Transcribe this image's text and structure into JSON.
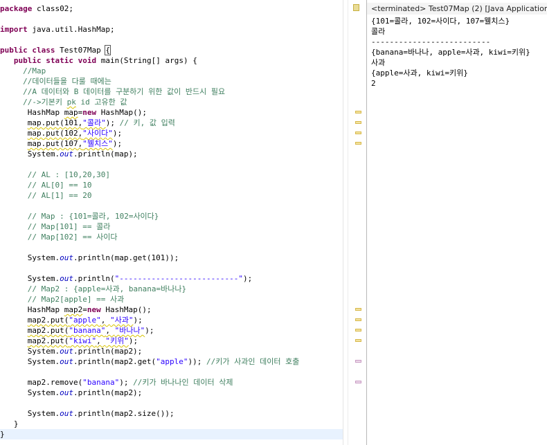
{
  "editor": {
    "lines": [
      {
        "segs": [
          {
            "t": "package",
            "c": "kw"
          },
          {
            "t": " class02;"
          }
        ]
      },
      {
        "segs": []
      },
      {
        "segs": [
          {
            "t": "import",
            "c": "kw"
          },
          {
            "t": " java.util.HashMap;"
          }
        ]
      },
      {
        "segs": []
      },
      {
        "segs": [
          {
            "t": "public",
            "c": "kw"
          },
          {
            "t": " "
          },
          {
            "t": "class",
            "c": "kw"
          },
          {
            "t": " Test07Map "
          },
          {
            "t": "{",
            "c": "box"
          }
        ]
      },
      {
        "segs": [
          {
            "t": "   "
          },
          {
            "t": "public",
            "c": "kw"
          },
          {
            "t": " "
          },
          {
            "t": "static",
            "c": "kw"
          },
          {
            "t": " "
          },
          {
            "t": "void",
            "c": "kw"
          },
          {
            "t": " main(String[] args) {"
          }
        ]
      },
      {
        "segs": [
          {
            "t": "     "
          },
          {
            "t": "//Map",
            "c": "cm"
          }
        ]
      },
      {
        "segs": [
          {
            "t": "     "
          },
          {
            "t": "//데이터들을 다룰 때에는",
            "c": "cm"
          }
        ]
      },
      {
        "segs": [
          {
            "t": "     "
          },
          {
            "t": "//A 데이터와 B 데이터를 구분하기 위한 값이 반드시 필요",
            "c": "cm"
          }
        ]
      },
      {
        "segs": [
          {
            "t": "     "
          },
          {
            "t": "//->기본키 ",
            "c": "cm"
          },
          {
            "t": "pk",
            "c": "cm ann"
          },
          {
            "t": " id 고유한 값",
            "c": "cm"
          }
        ]
      },
      {
        "segs": [
          {
            "t": "      HashMap "
          },
          {
            "t": "map",
            "c": "ann"
          },
          {
            "t": "="
          },
          {
            "t": "new",
            "c": "kw"
          },
          {
            "t": " HashMap();"
          }
        ]
      },
      {
        "segs": [
          {
            "t": "      "
          },
          {
            "t": "map.put(101,",
            "c": "ann"
          },
          {
            "t": "\"콜라\"",
            "c": "st ann"
          },
          {
            "t": "); "
          },
          {
            "t": "// 키, 값 입력",
            "c": "cm"
          }
        ]
      },
      {
        "segs": [
          {
            "t": "      "
          },
          {
            "t": "map.put(102,",
            "c": "ann"
          },
          {
            "t": "\"사이다\"",
            "c": "st ann"
          },
          {
            "t": ");"
          }
        ]
      },
      {
        "segs": [
          {
            "t": "      "
          },
          {
            "t": "map.put(107,",
            "c": "ann"
          },
          {
            "t": "\"웰치스\"",
            "c": "st ann"
          },
          {
            "t": ");"
          }
        ]
      },
      {
        "segs": [
          {
            "t": "      System."
          },
          {
            "t": "out",
            "c": "it"
          },
          {
            "t": ".println(map);"
          }
        ]
      },
      {
        "segs": []
      },
      {
        "segs": [
          {
            "t": "      "
          },
          {
            "t": "// AL : [10,20,30]",
            "c": "cm"
          }
        ]
      },
      {
        "segs": [
          {
            "t": "      "
          },
          {
            "t": "// AL[0] == 10",
            "c": "cm"
          }
        ]
      },
      {
        "segs": [
          {
            "t": "      "
          },
          {
            "t": "// AL[1] == 20",
            "c": "cm"
          }
        ]
      },
      {
        "segs": []
      },
      {
        "segs": [
          {
            "t": "      "
          },
          {
            "t": "// Map : {101=콜라, 102=사이다}",
            "c": "cm"
          }
        ]
      },
      {
        "segs": [
          {
            "t": "      "
          },
          {
            "t": "// Map[101] == 콜라",
            "c": "cm"
          }
        ]
      },
      {
        "segs": [
          {
            "t": "      "
          },
          {
            "t": "// Map[102] == 사이다",
            "c": "cm"
          }
        ]
      },
      {
        "segs": []
      },
      {
        "segs": [
          {
            "t": "      System."
          },
          {
            "t": "out",
            "c": "it"
          },
          {
            "t": ".println(map.get(101));"
          }
        ]
      },
      {
        "segs": []
      },
      {
        "segs": [
          {
            "t": "      System."
          },
          {
            "t": "out",
            "c": "it"
          },
          {
            "t": ".println("
          },
          {
            "t": "\"--------------------------\"",
            "c": "st"
          },
          {
            "t": ");"
          }
        ]
      },
      {
        "segs": [
          {
            "t": "      "
          },
          {
            "t": "// Map2 : {apple=사과, banana=바나나}",
            "c": "cm"
          }
        ]
      },
      {
        "segs": [
          {
            "t": "      "
          },
          {
            "t": "// Map2[apple] == 사과",
            "c": "cm"
          }
        ]
      },
      {
        "segs": [
          {
            "t": "      HashMap "
          },
          {
            "t": "map2",
            "c": "ann"
          },
          {
            "t": "="
          },
          {
            "t": "new",
            "c": "kw"
          },
          {
            "t": " HashMap();"
          }
        ]
      },
      {
        "segs": [
          {
            "t": "      "
          },
          {
            "t": "map2.put(",
            "c": "ann"
          },
          {
            "t": "\"apple\"",
            "c": "st ann"
          },
          {
            "t": ", ",
            "c": "ann"
          },
          {
            "t": "\"사과\"",
            "c": "st ann"
          },
          {
            "t": ");"
          }
        ]
      },
      {
        "segs": [
          {
            "t": "      "
          },
          {
            "t": "map2.put(",
            "c": "ann"
          },
          {
            "t": "\"banana\"",
            "c": "st ann"
          },
          {
            "t": ", ",
            "c": "ann"
          },
          {
            "t": "\"바나나\"",
            "c": "st ann"
          },
          {
            "t": ");"
          }
        ]
      },
      {
        "segs": [
          {
            "t": "      "
          },
          {
            "t": "map2.put(",
            "c": "ann"
          },
          {
            "t": "\"kiwi\"",
            "c": "st ann"
          },
          {
            "t": ", ",
            "c": "ann"
          },
          {
            "t": "\"키위\"",
            "c": "st ann"
          },
          {
            "t": ");"
          }
        ]
      },
      {
        "segs": [
          {
            "t": "      System."
          },
          {
            "t": "out",
            "c": "it"
          },
          {
            "t": ".println(map2);"
          }
        ]
      },
      {
        "segs": [
          {
            "t": "      System."
          },
          {
            "t": "out",
            "c": "it"
          },
          {
            "t": ".println(map2.get("
          },
          {
            "t": "\"apple\"",
            "c": "st"
          },
          {
            "t": ")); "
          },
          {
            "t": "//키가 사과인 데이터 호출",
            "c": "cm"
          }
        ]
      },
      {
        "segs": []
      },
      {
        "segs": [
          {
            "t": "      map2.remove("
          },
          {
            "t": "\"banana\"",
            "c": "st"
          },
          {
            "t": "); "
          },
          {
            "t": "//키가 바나나인 데이터 삭제",
            "c": "cm"
          }
        ]
      },
      {
        "segs": [
          {
            "t": "      System."
          },
          {
            "t": "out",
            "c": "it"
          },
          {
            "t": ".println(map2);"
          }
        ]
      },
      {
        "segs": []
      },
      {
        "segs": [
          {
            "t": "      System."
          },
          {
            "t": "out",
            "c": "it"
          },
          {
            "t": ".println(map2.size());"
          }
        ]
      },
      {
        "segs": [
          {
            "t": "   }"
          }
        ]
      },
      {
        "segs": [
          {
            "t": "}"
          }
        ],
        "current": true
      }
    ]
  },
  "gutter": {
    "markers": [
      {
        "line": 10,
        "kind": "warn"
      },
      {
        "line": 11,
        "kind": "warn"
      },
      {
        "line": 12,
        "kind": "warn"
      },
      {
        "line": 13,
        "kind": "warn"
      },
      {
        "line": 29,
        "kind": "warn"
      },
      {
        "line": 30,
        "kind": "warn"
      },
      {
        "line": 31,
        "kind": "warn"
      },
      {
        "line": 32,
        "kind": "warn"
      },
      {
        "line": 34,
        "kind": "info"
      },
      {
        "line": 36,
        "kind": "info"
      }
    ]
  },
  "console": {
    "header": "<terminated> Test07Map (2) [Java Application]",
    "output": [
      "{101=콜라, 102=사이다, 107=웰치스}",
      "콜라",
      "--------------------------",
      "{banana=바나나, apple=사과, kiwi=키위}",
      "사과",
      "{apple=사과, kiwi=키위}",
      "2"
    ]
  }
}
